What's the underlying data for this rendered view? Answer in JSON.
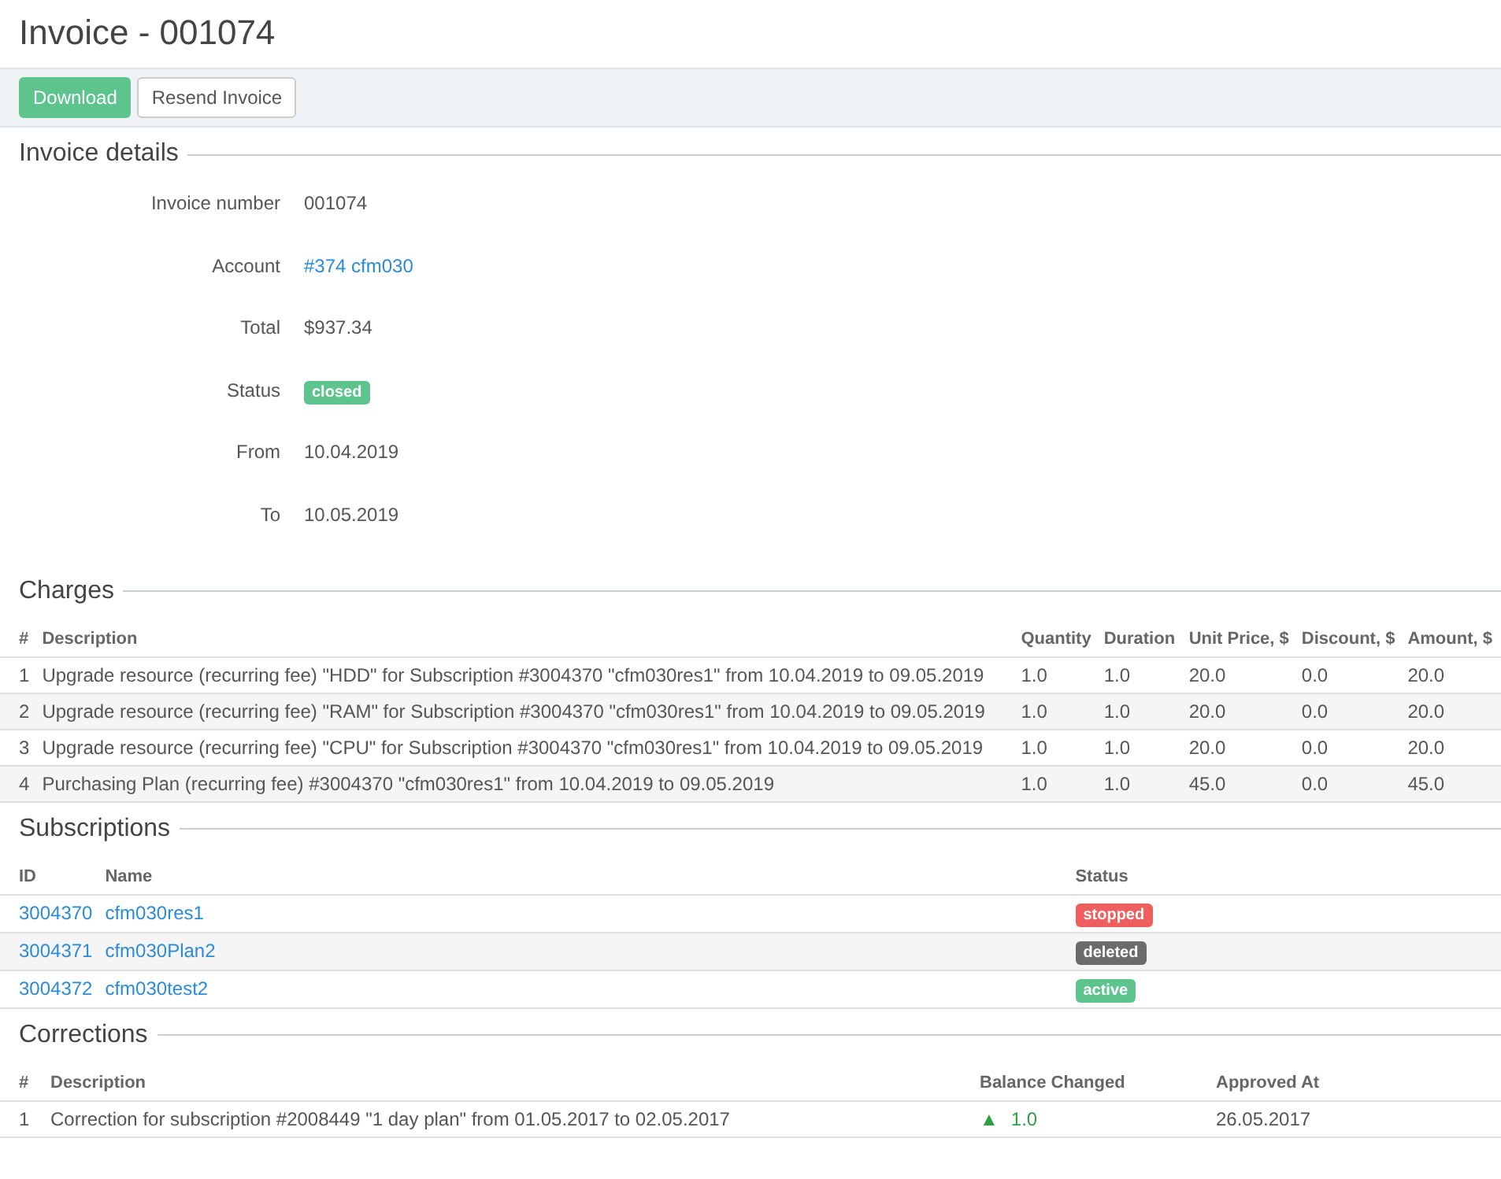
{
  "title": "Invoice - 001074",
  "toolbar": [
    {
      "label": "Download",
      "kind": "primary"
    },
    {
      "label": "Resend Invoice",
      "kind": "default"
    }
  ],
  "details": {
    "heading": "Invoice details",
    "fields": [
      {
        "label": "Invoice number",
        "value": "001074",
        "kind": "text"
      },
      {
        "label": "Account",
        "value": "#374 cfm030",
        "kind": "link"
      },
      {
        "label": "Total",
        "value": "$937.34",
        "kind": "text"
      },
      {
        "label": "Status",
        "value": "closed",
        "kind": "badge",
        "color": "#5ec48e"
      },
      {
        "label": "From",
        "value": "10.04.2019",
        "kind": "text"
      },
      {
        "label": "To",
        "value": "10.05.2019",
        "kind": "text"
      }
    ]
  },
  "charges": {
    "heading": "Charges",
    "columns": [
      "#",
      "Description",
      "Quantity",
      "Duration",
      "Unit Price, $",
      "Discount, $",
      "Amount, $"
    ],
    "rows": [
      [
        "1",
        "Upgrade resource (recurring fee) \"HDD\" for Subscription #3004370 \"cfm030res1\" from 10.04.2019 to 09.05.2019",
        "1.0",
        "1.0",
        "20.0",
        "0.0",
        "20.0"
      ],
      [
        "2",
        "Upgrade resource (recurring fee) \"RAM\" for Subscription #3004370 \"cfm030res1\" from 10.04.2019 to 09.05.2019",
        "1.0",
        "1.0",
        "20.0",
        "0.0",
        "20.0"
      ],
      [
        "3",
        "Upgrade resource (recurring fee) \"CPU\" for Subscription #3004370 \"cfm030res1\" from 10.04.2019 to 09.05.2019",
        "1.0",
        "1.0",
        "20.0",
        "0.0",
        "20.0"
      ],
      [
        "4",
        "Purchasing Plan (recurring fee) #3004370 \"cfm030res1\" from 10.04.2019 to 09.05.2019",
        "1.0",
        "1.0",
        "45.0",
        "0.0",
        "45.0"
      ]
    ]
  },
  "subscriptions": {
    "heading": "Subscriptions",
    "columns": [
      "ID",
      "Name",
      "Status"
    ],
    "rows": [
      {
        "id": "3004370",
        "name": "cfm030res1",
        "status": "stopped",
        "color": "#ef5f5f"
      },
      {
        "id": "3004371",
        "name": "cfm030Plan2",
        "status": "deleted",
        "color": "#6b6b6b"
      },
      {
        "id": "3004372",
        "name": "cfm030test2",
        "status": "active",
        "color": "#5ec48e"
      }
    ]
  },
  "corrections": {
    "heading": "Corrections",
    "columns": [
      "#",
      "Description",
      "Balance Changed",
      "Approved At"
    ],
    "rows": [
      {
        "number": "1",
        "description": "Correction for subscription #2008449 \"1 day plan\" from 01.05.2017 to 02.05.2017",
        "arrow": "▲",
        "balance": "1.0",
        "approved_at": "26.05.2017"
      }
    ]
  }
}
